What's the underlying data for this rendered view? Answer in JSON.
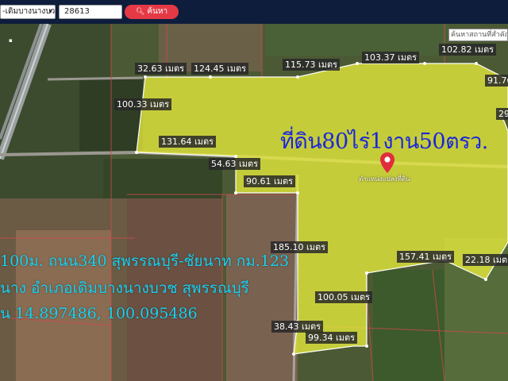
{
  "search": {
    "district_value": "-เดิมบางนางบวช",
    "parcel_value": "28613",
    "search_label": "ค้นหา"
  },
  "map": {
    "place_search_placeholder": "ค้นหาสถานที่สำคัญ",
    "headline": "ที่ดิน80ไร่1งาน50ตรว.",
    "pin_label": "ตำแหน่งแปลงที่ดิน",
    "info_lines": [
      "100ม. ถนน340 สุพรรณบุรี-ชัยนาท กม.123",
      "นาง อำเภอเดิมบางนางบวช สุพรรณบุรี",
      "น 14.897486, 100.095486"
    ],
    "measurements": [
      "32.63 เมตร",
      "124.45 เมตร",
      "115.73 เมตร",
      "103.37 เมตร",
      "102.82 เมตร",
      "91.76",
      "100.33 เมตร",
      "29",
      "131.64 เมตร",
      "54.63 เมตร",
      "90.61 เมตร",
      "185.10 เมตร",
      "157.41 เมตร",
      "22.18 เมตร",
      "100.05 เมตร",
      "38.43 เมตร",
      "99.34 เมตร"
    ],
    "colors": {
      "parcel_fill": "#e8ec3c",
      "headline": "#1a27d8",
      "info": "#1ad0f0",
      "pin": "#e02d3c",
      "topbar": "#0f1d3c"
    }
  }
}
